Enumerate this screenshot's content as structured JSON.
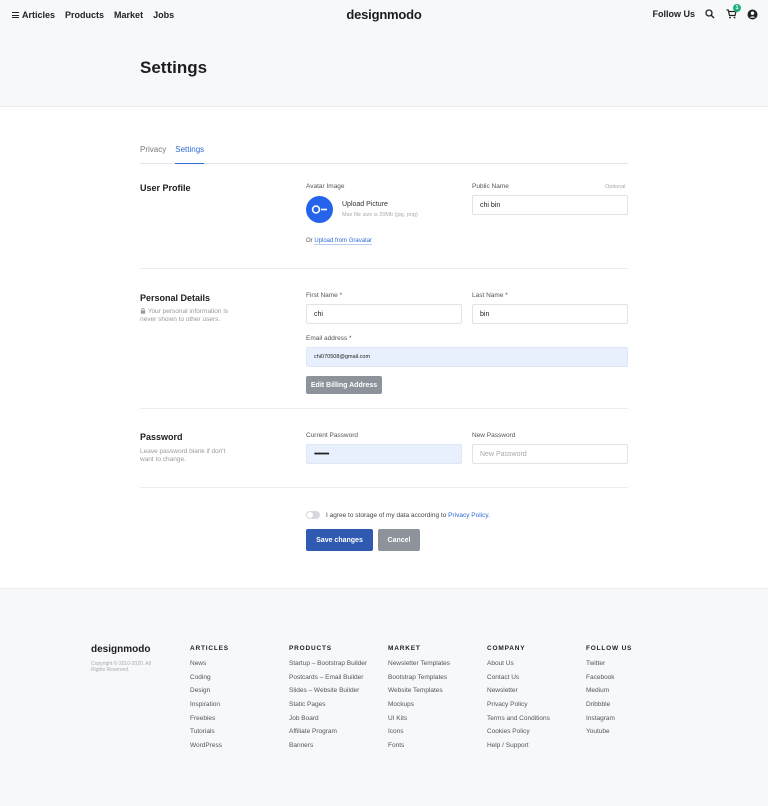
{
  "header": {
    "nav_left": [
      "Articles",
      "Products",
      "Market",
      "Jobs"
    ],
    "logo": "designmodo",
    "follow_us": "Follow Us",
    "cart_count": "1",
    "page_title": "Settings"
  },
  "tabs": [
    {
      "label": "Privacy",
      "active": false
    },
    {
      "label": "Settings",
      "active": true
    }
  ],
  "user_profile": {
    "title": "User Profile",
    "avatar_label": "Avatar Image",
    "upload_title": "Upload Picture",
    "upload_note": "Max file size is 20Mb (jpg, png)",
    "gravatar_prefix": "Or",
    "gravatar_link": "Upload from Gravatar",
    "public_name_label": "Public Name",
    "optional": "Optional",
    "public_name_value": "chi bin"
  },
  "personal": {
    "title": "Personal Details",
    "note": "Your personal information is never shown to other users.",
    "first_name_label": "First Name *",
    "first_name_value": "chi",
    "last_name_label": "Last Name *",
    "last_name_value": "bin",
    "email_label": "Email address *",
    "email_value": "chi070508@gmail.com",
    "billing_button": "Edit Billing Address"
  },
  "password": {
    "title": "Password",
    "note": "Leave password blank if don't want to change.",
    "current_label": "Current Password",
    "current_value": "••••••••••",
    "new_label": "New Password",
    "new_placeholder": "New Password"
  },
  "consent": {
    "text": "I agree to storage of my data according to",
    "link": "Privacy Policy."
  },
  "actions": {
    "save": "Save changes",
    "cancel": "Cancel"
  },
  "footer": {
    "logo": "designmodo",
    "copyright": "Copyright © 2010-2020. All Rights Reserved.",
    "columns": [
      {
        "title": "ARTICLES",
        "items": [
          "News",
          "Coding",
          "Design",
          "Inspiration",
          "Freebies",
          "Tutorials",
          "WordPress"
        ]
      },
      {
        "title": "PRODUCTS",
        "items": [
          "Startup – Bootstrap Builder",
          "Postcards – Email Builder",
          "Slides – Website Builder",
          "Static Pages",
          "Job Board",
          "Affiliate Program",
          "Banners"
        ]
      },
      {
        "title": "MARKET",
        "items": [
          "Newsletter Templates",
          "Bootstrap Templates",
          "Website Templates",
          "Mockups",
          "UI Kits",
          "Icons",
          "Fonts"
        ]
      },
      {
        "title": "COMPANY",
        "items": [
          "About Us",
          "Contact Us",
          "Newsletter",
          "Privacy Policy",
          "Terms and Conditions",
          "Cookies Policy",
          "Help / Support"
        ]
      },
      {
        "title": "FOLLOW US",
        "items": [
          "Twitter",
          "Facebook",
          "Medium",
          "Dribbble",
          "Instagram",
          "Youtube"
        ]
      }
    ]
  },
  "colors": {
    "accent": "#2f6bd3",
    "primary_button": "#2f5ab1",
    "avatar": "#2563eb",
    "badge": "#21b07a"
  }
}
